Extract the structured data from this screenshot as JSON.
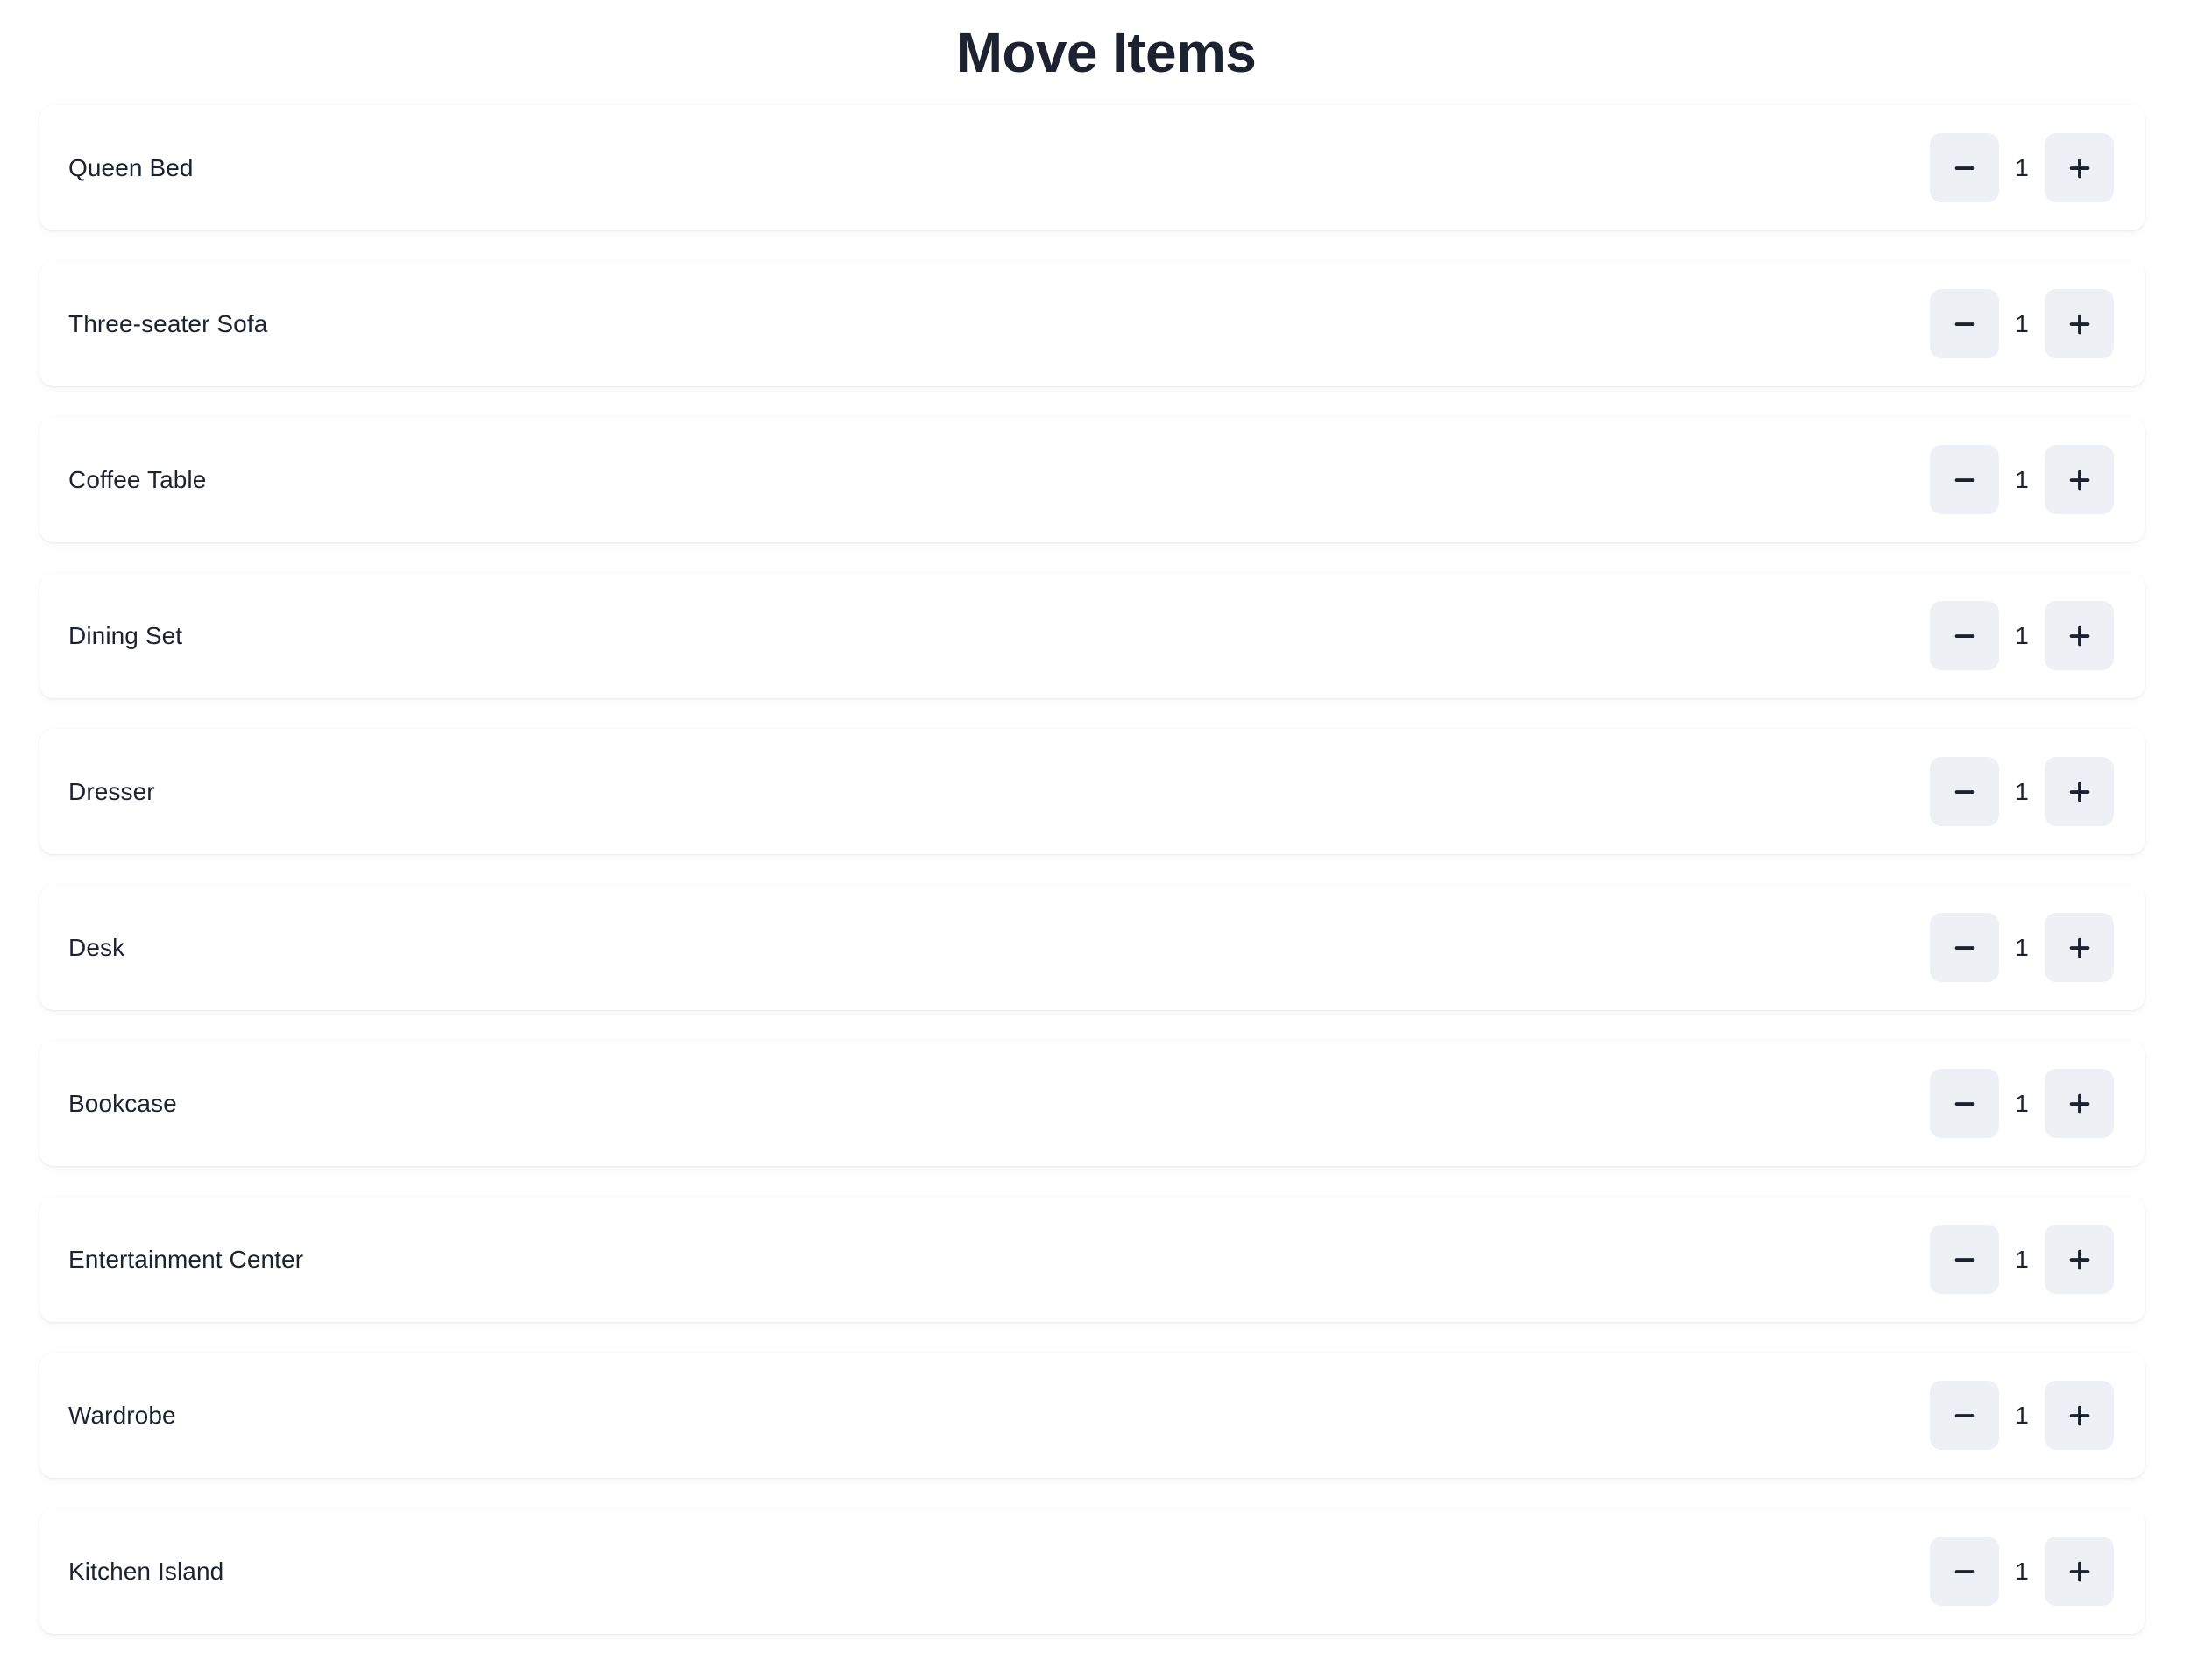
{
  "page": {
    "title": "Move Items",
    "background_color": "#ffffff",
    "text_color": "#1c2230"
  },
  "theme": {
    "card_background": "#ffffff",
    "stepper_button_background": "#edf1f5",
    "stepper_glyph_color": "#1c2230"
  },
  "stepper": {
    "decrease_label": "minus",
    "increase_label": "plus"
  },
  "items": [
    {
      "name": "Queen Bed",
      "quantity": "1"
    },
    {
      "name": "Three-seater Sofa",
      "quantity": "1"
    },
    {
      "name": "Coffee Table",
      "quantity": "1"
    },
    {
      "name": "Dining Set",
      "quantity": "1"
    },
    {
      "name": "Dresser",
      "quantity": "1"
    },
    {
      "name": "Desk",
      "quantity": "1"
    },
    {
      "name": "Bookcase",
      "quantity": "1"
    },
    {
      "name": "Entertainment Center",
      "quantity": "1"
    },
    {
      "name": "Wardrobe",
      "quantity": "1"
    },
    {
      "name": "Kitchen Island",
      "quantity": "1"
    }
  ]
}
